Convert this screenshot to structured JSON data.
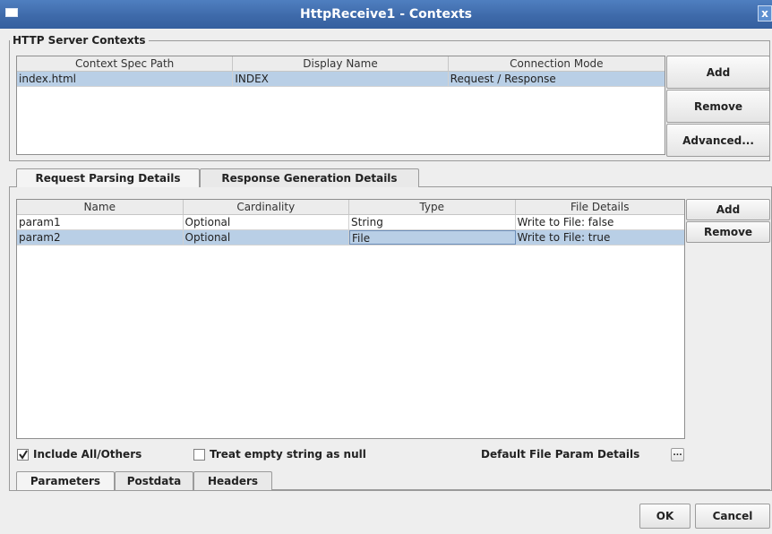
{
  "window": {
    "title": "HttpReceive1 - Contexts",
    "close_glyph": "x"
  },
  "server_contexts": {
    "label": "HTTP Server Contexts",
    "columns": [
      "Context Spec Path",
      "Display Name",
      "Connection Mode"
    ],
    "rows": [
      [
        "index.html",
        "INDEX",
        "Request / Response"
      ]
    ],
    "buttons": {
      "add": "Add",
      "remove": "Remove",
      "advanced": "Advanced..."
    }
  },
  "detail_tabs": [
    "Request Parsing Details",
    "Response Generation Details"
  ],
  "params": {
    "columns": [
      "Name",
      "Cardinality",
      "Type",
      "File Details"
    ],
    "rows": [
      [
        "param1",
        "Optional",
        "String",
        "Write to File: false"
      ],
      [
        "param2",
        "Optional",
        "File",
        "Write to File: true"
      ]
    ],
    "buttons": {
      "add": "Add",
      "remove": "Remove"
    }
  },
  "options": {
    "include_all_others": {
      "label": "Include All/Others",
      "checked": true
    },
    "treat_empty_null": {
      "label": "Treat empty string as null",
      "checked": false
    },
    "default_file_param": {
      "label": "Default File Param Details",
      "button": "..."
    }
  },
  "bottom_tabs": [
    "Parameters",
    "Postdata",
    "Headers"
  ],
  "footer": {
    "ok": "OK",
    "cancel": "Cancel"
  },
  "colors": {
    "titlebar": "#3e6aaa",
    "selection": "#b9cfe6"
  }
}
